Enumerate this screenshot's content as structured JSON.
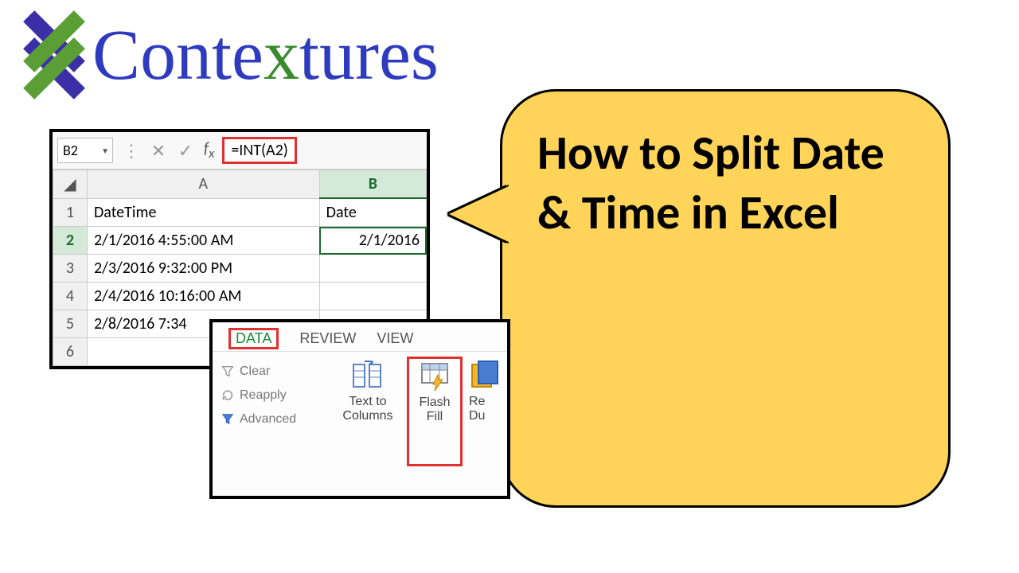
{
  "logo": {
    "pre": "Conte",
    "x": "x",
    "post": "tures"
  },
  "bubble": {
    "text": "How to Split Date & Time in Excel"
  },
  "excel1": {
    "namebox": "B2",
    "formula": "=INT(A2)",
    "columns": [
      "A",
      "B"
    ],
    "rows": [
      {
        "n": "1",
        "a": "DateTime",
        "b": "Date"
      },
      {
        "n": "2",
        "a": "2/1/2016 4:55:00 AM",
        "b": "2/1/2016"
      },
      {
        "n": "3",
        "a": "2/3/2016 9:32:00 PM",
        "b": ""
      },
      {
        "n": "4",
        "a": "2/4/2016 10:16:00 AM",
        "b": ""
      },
      {
        "n": "5",
        "a": "2/8/2016 7:34",
        "b": ""
      },
      {
        "n": "6",
        "a": "",
        "b": ""
      }
    ]
  },
  "ribbon": {
    "tabs": {
      "data": "DATA",
      "review": "REVIEW",
      "view": "VIEW"
    },
    "clear": "Clear",
    "reapply": "Reapply",
    "advanced": "Advanced",
    "textto": "Text to",
    "columns": "Columns",
    "flash": "Flash",
    "fill": "Fill",
    "rem": "Re",
    "dup": "Du"
  }
}
